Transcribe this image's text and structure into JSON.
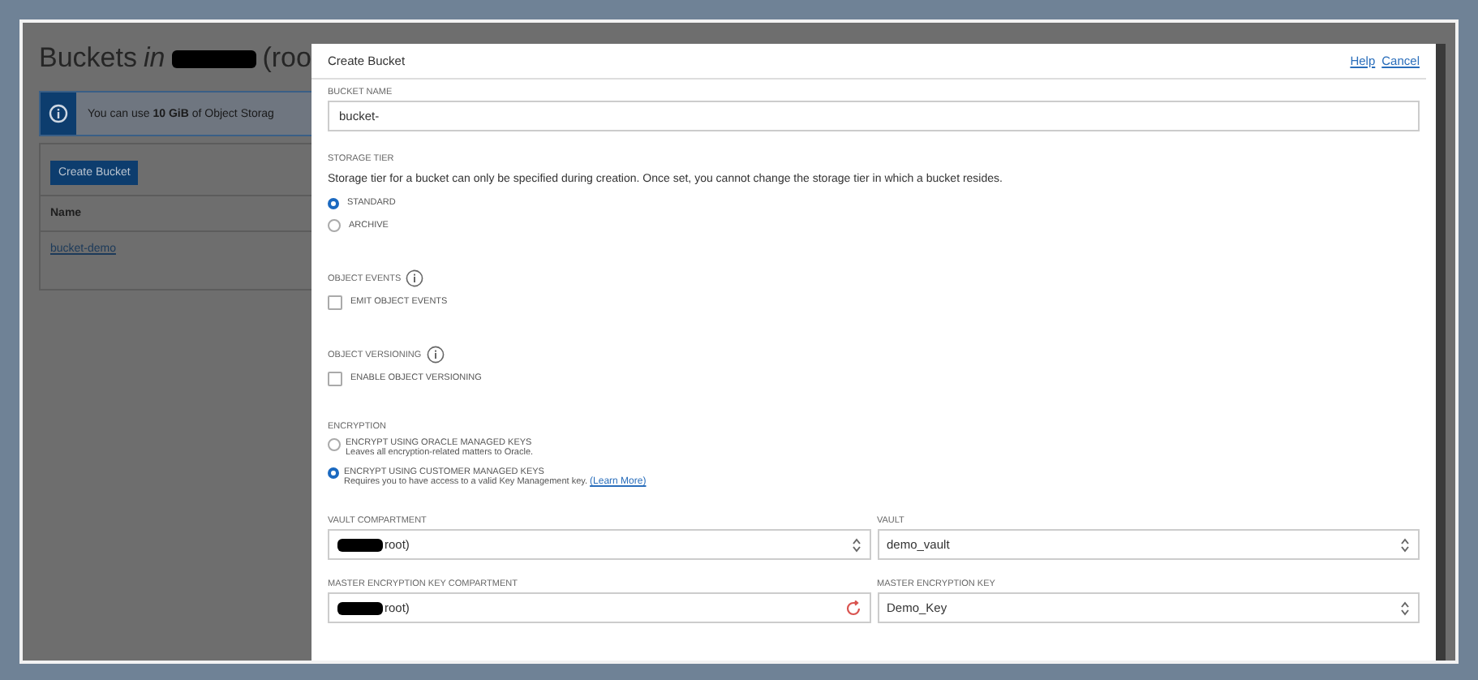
{
  "page": {
    "title": "Buckets",
    "title_in": "in",
    "title_tail": "(roo",
    "title_redacted": true,
    "info_banner": "You can use **10 GiB** of Object Storag",
    "create_button": "Create Bucket",
    "table": {
      "columns": [
        "Name"
      ],
      "rows": [
        "bucket-demo"
      ]
    }
  },
  "modal": {
    "title": "Create Bucket",
    "links": [
      "Help",
      "Cancel"
    ],
    "bucket_name": {
      "label": "BUCKET NAME",
      "value": "bucket-"
    },
    "storage_tier": {
      "label": "STORAGE TIER",
      "note": "Storage tier for a bucket can only be specified during creation. Once set, you cannot change the storage tier in which a bucket resides.",
      "options": [
        {
          "label": "STANDARD",
          "selected": true
        },
        {
          "label": "ARCHIVE",
          "selected": false
        }
      ]
    },
    "toggles": [
      {
        "label": "OBJECT EVENTS",
        "checkbox": "EMIT OBJECT EVENTS",
        "checked": false
      },
      {
        "label": "OBJECT VERSIONING",
        "checkbox": "ENABLE OBJECT VERSIONING",
        "checked": false
      }
    ],
    "encryption": {
      "label": "ENCRYPTION",
      "options": [
        {
          "label": "ENCRYPT USING ORACLE MANAGED KEYS",
          "description": "Leaves all encryption-related matters to Oracle.",
          "selected": false
        },
        {
          "label": "ENCRYPT USING CUSTOMER MANAGED KEYS",
          "description": "Requires you to have access to a valid Key Management key.",
          "link": "(Learn More)",
          "selected": true
        }
      ]
    },
    "selects": [
      {
        "label": "VAULT COMPARTMENT",
        "value": "root)",
        "redacted": true,
        "kind": "updown"
      },
      {
        "label": "VAULT",
        "value": "demo_vault",
        "redacted": false,
        "kind": "updown"
      },
      {
        "label": "MASTER ENCRYPTION KEY COMPARTMENT",
        "value": "root)",
        "redacted": true,
        "kind": "loading"
      },
      {
        "label": "MASTER ENCRYPTION KEY",
        "value": "Demo_Key",
        "redacted": false,
        "kind": "updown"
      }
    ]
  }
}
